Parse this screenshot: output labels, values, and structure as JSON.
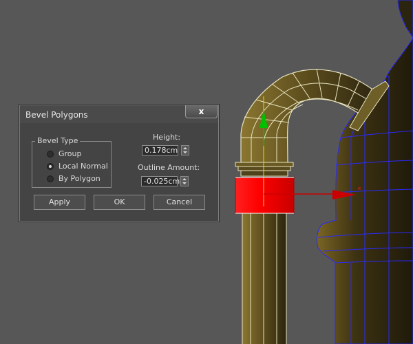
{
  "dialog": {
    "title": "Bevel Polygons",
    "close_icon": "close-icon",
    "close_glyph": "x",
    "bevel_type": {
      "label": "Bevel Type",
      "options": [
        {
          "label": "Group",
          "selected": false
        },
        {
          "label": "Local Normal",
          "selected": true
        },
        {
          "label": "By Polygon",
          "selected": false
        }
      ]
    },
    "height": {
      "label": "Height:",
      "value": "0.178cm"
    },
    "outline_amount": {
      "label": "Outline Amount:",
      "value": "-0.025cm"
    },
    "buttons": {
      "apply": "Apply",
      "ok": "OK",
      "cancel": "Cancel"
    }
  },
  "viewport": {
    "colors": {
      "background": "#575757",
      "wire": "#e8e4c0",
      "selected_polygons": "#ff0000",
      "gizmo_y_axis": "#00c000",
      "gizmo_x_axis": "#cc0000",
      "mesh_edges_blue": "#2a2aff"
    }
  }
}
